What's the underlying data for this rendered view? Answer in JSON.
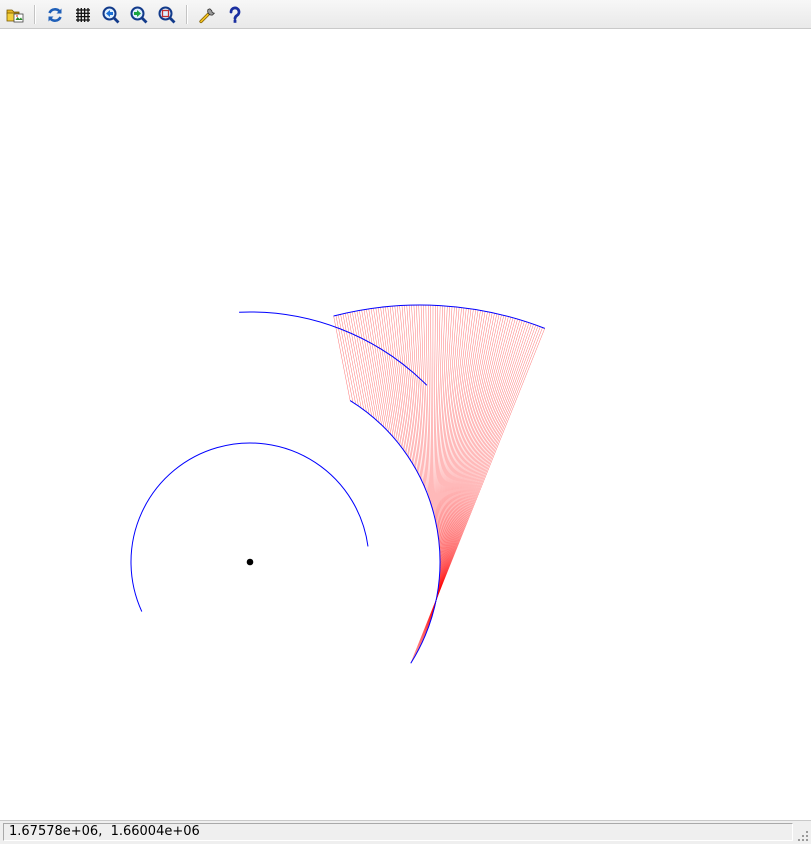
{
  "toolbar": {
    "buttons": [
      {
        "name": "open-file-button",
        "icon": "folder-open-icon"
      },
      {
        "name": "refresh-button",
        "icon": "refresh-icon"
      },
      {
        "name": "grid-button",
        "icon": "grid-icon"
      },
      {
        "name": "zoom-back-button",
        "icon": "zoom-back-icon"
      },
      {
        "name": "zoom-forward-button",
        "icon": "zoom-forward-icon"
      },
      {
        "name": "zoom-fit-button",
        "icon": "zoom-fit-icon"
      },
      {
        "name": "settings-button",
        "icon": "wrench-icon"
      },
      {
        "name": "help-button",
        "icon": "help-icon"
      }
    ]
  },
  "plot": {
    "arc_color": "#0000ff",
    "fan_color": "#ff0000",
    "point_color": "#000000",
    "background": "#ffffff"
  },
  "status": {
    "coordinates": "1.67578e+06,  1.66004e+06"
  }
}
